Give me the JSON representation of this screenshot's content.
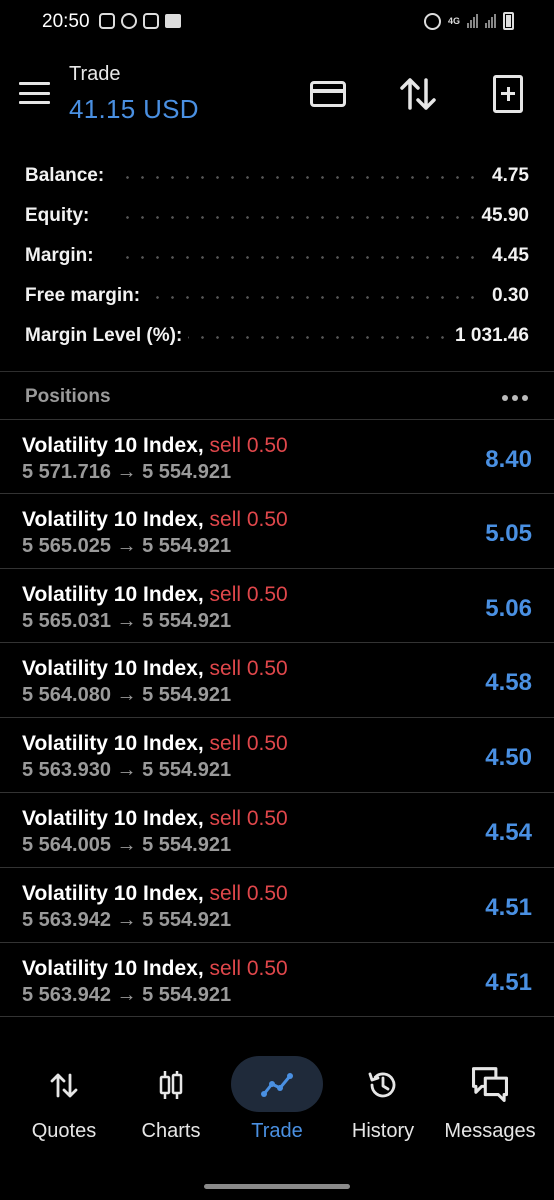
{
  "status_bar": {
    "time": "20:50",
    "network": "4G"
  },
  "header": {
    "title": "Trade",
    "subtitle": "41.15 USD"
  },
  "summary": [
    {
      "label": "Balance:",
      "value": "4.75"
    },
    {
      "label": "Equity:",
      "value": "45.90"
    },
    {
      "label": "Margin:",
      "value": "4.45"
    },
    {
      "label": "Free margin:",
      "value": "0.30"
    },
    {
      "label": "Margin Level (%):",
      "value": "1 031.46"
    }
  ],
  "positions": {
    "title": "Positions",
    "items": [
      {
        "symbol": "Volatility 10 Index,",
        "side": "sell 0.50",
        "prices": "5 571.716 → 5 554.921",
        "profit": "8.40"
      },
      {
        "symbol": "Volatility 10 Index,",
        "side": "sell 0.50",
        "prices": "5 565.025 → 5 554.921",
        "profit": "5.05"
      },
      {
        "symbol": "Volatility 10 Index,",
        "side": "sell 0.50",
        "prices": "5 565.031 → 5 554.921",
        "profit": "5.06"
      },
      {
        "symbol": "Volatility 10 Index,",
        "side": "sell 0.50",
        "prices": "5 564.080 → 5 554.921",
        "profit": "4.58"
      },
      {
        "symbol": "Volatility 10 Index,",
        "side": "sell 0.50",
        "prices": "5 563.930 → 5 554.921",
        "profit": "4.50"
      },
      {
        "symbol": "Volatility 10 Index,",
        "side": "sell 0.50",
        "prices": "5 564.005 → 5 554.921",
        "profit": "4.54"
      },
      {
        "symbol": "Volatility 10 Index,",
        "side": "sell 0.50",
        "prices": "5 563.942 → 5 554.921",
        "profit": "4.51"
      },
      {
        "symbol": "Volatility 10 Index,",
        "side": "sell 0.50",
        "prices": "5 563.942 → 5 554.921",
        "profit": "4.51"
      }
    ]
  },
  "nav": [
    {
      "label": "Quotes",
      "icon": "quotes-icon",
      "active": false
    },
    {
      "label": "Charts",
      "icon": "charts-icon",
      "active": false
    },
    {
      "label": "Trade",
      "icon": "trade-icon",
      "active": true
    },
    {
      "label": "History",
      "icon": "history-icon",
      "active": false
    },
    {
      "label": "Messages",
      "icon": "messages-icon",
      "active": false
    }
  ],
  "colors": {
    "accent": "#4a90e2",
    "sell": "#e0474b",
    "background": "#000000"
  }
}
